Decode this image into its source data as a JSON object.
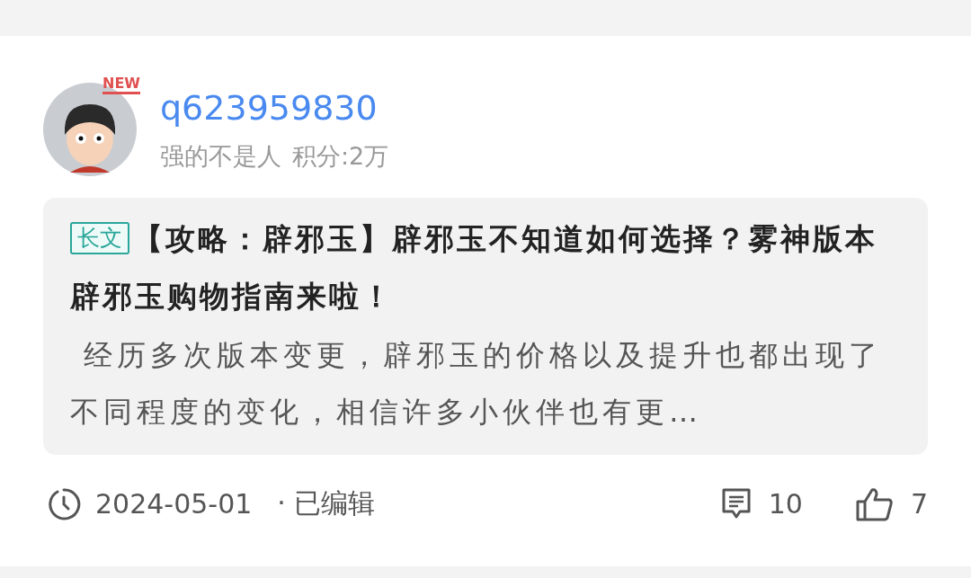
{
  "post": {
    "author": {
      "badge": "NEW",
      "username": "q623959830",
      "title": "强的不是人",
      "points": "积分:2万"
    },
    "tag": "长文",
    "title": "【攻略：辟邪玉】辟邪玉不知道如何选择？雾神版本辟邪玉购物指南来啦！",
    "excerpt": " 经历多次版本变更，辟邪玉的价格以及提升也都出现了不同程度的变化，相信许多小伙伴也有更…",
    "date": "2024-05-01",
    "edited_label": "· 已编辑",
    "comments": "10",
    "likes": "7"
  }
}
